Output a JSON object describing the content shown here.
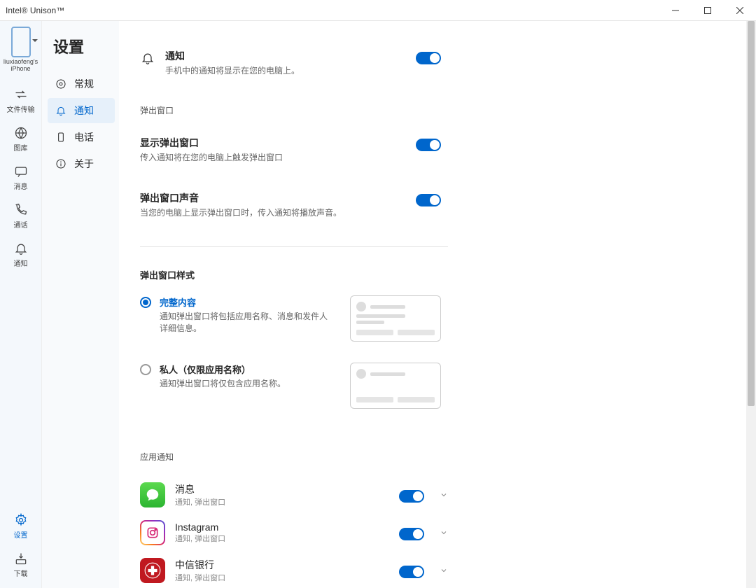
{
  "window": {
    "title": "Intel® Unison™"
  },
  "sidebar": {
    "device_label": "liuxiaofeng's iPhone",
    "items": [
      {
        "label": "文件传输"
      },
      {
        "label": "图库"
      },
      {
        "label": "消息"
      },
      {
        "label": "通话"
      },
      {
        "label": "通知"
      }
    ],
    "bottom": [
      {
        "label": "设置"
      },
      {
        "label": "下载"
      }
    ]
  },
  "sub": {
    "title": "设置",
    "items": [
      {
        "label": "常规"
      },
      {
        "label": "通知"
      },
      {
        "label": "电话"
      },
      {
        "label": "关于"
      }
    ]
  },
  "settings": {
    "notify": {
      "title": "通知",
      "desc": "手机中的通知将显示在您的电脑上。"
    },
    "popup_section": "弹出窗口",
    "show_popup": {
      "title": "显示弹出窗口",
      "desc": "传入通知将在您的电脑上触发弹出窗口"
    },
    "popup_sound": {
      "title": "弹出窗口声音",
      "desc": "当您的电脑上显示弹出窗口时，传入通知将播放声音。"
    },
    "style_section": "弹出窗口样式",
    "style_full": {
      "title": "完整内容",
      "desc": "通知弹出窗口将包括应用名称、消息和发件人详细信息。"
    },
    "style_private": {
      "title": "私人（仅限应用名称）",
      "desc": "通知弹出窗口将仅包含应用名称。"
    },
    "apps_section": "应用通知",
    "apps": [
      {
        "name": "消息",
        "desc": "通知, 弹出窗口",
        "icon": "messages"
      },
      {
        "name": "Instagram",
        "desc": "通知, 弹出窗口",
        "icon": "instagram"
      },
      {
        "name": "中信银行",
        "desc": "通知, 弹出窗口",
        "icon": "citic"
      }
    ]
  }
}
